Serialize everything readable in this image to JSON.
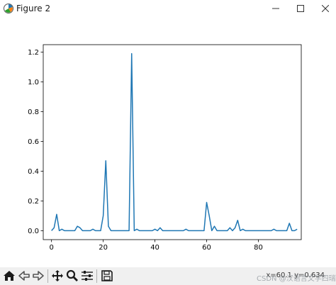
{
  "window": {
    "title": "Figure 2",
    "icon": "matplotlib-icon",
    "controls": [
      "minimize-icon",
      "maximize-icon",
      "close-icon"
    ]
  },
  "toolbar": {
    "buttons": [
      "home-icon",
      "back-arrow-icon",
      "forward-arrow-icon",
      "pan-icon",
      "zoom-icon",
      "configure-subplots-icon",
      "save-icon"
    ],
    "coords": "x=60.1  y=0.634"
  },
  "watermark": "CSDN @汉语言文学四瑞",
  "chart_data": {
    "type": "line",
    "title": "",
    "xlabel": "",
    "ylabel": "",
    "xlim": [
      -3.2,
      96.6
    ],
    "ylim": [
      -0.06,
      1.25
    ],
    "xticks": [
      0,
      20,
      40,
      60,
      80
    ],
    "yticks": [
      0.0,
      0.2,
      0.4,
      0.6,
      0.8,
      1.0,
      1.2
    ],
    "ytick_labels": [
      "0.0",
      "0.2",
      "0.4",
      "0.6",
      "0.8",
      "1.0",
      "1.2"
    ],
    "grid": false,
    "series": [
      {
        "color": "#1f77b4",
        "x": [
          0,
          1,
          2,
          3,
          4,
          5,
          6,
          7,
          8,
          9,
          10,
          11,
          12,
          13,
          14,
          15,
          16,
          17,
          18,
          19,
          20,
          21,
          22,
          23,
          24,
          25,
          26,
          27,
          28,
          29,
          30,
          31,
          32,
          33,
          34,
          35,
          36,
          37,
          38,
          39,
          40,
          41,
          42,
          43,
          44,
          45,
          46,
          47,
          48,
          49,
          50,
          51,
          52,
          53,
          54,
          55,
          56,
          57,
          58,
          59,
          60,
          61,
          62,
          63,
          64,
          65,
          66,
          67,
          68,
          69,
          70,
          71,
          72,
          73,
          74,
          75,
          76,
          77,
          78,
          79,
          80,
          81,
          82,
          83,
          84,
          85,
          86,
          87,
          88,
          89,
          90,
          91,
          92,
          93,
          94,
          95
        ],
        "y": [
          0.0,
          0.02,
          0.11,
          0.0,
          0.01,
          0.0,
          0.0,
          0.0,
          0.0,
          0.0,
          0.03,
          0.02,
          0.0,
          0.0,
          0.0,
          0.0,
          0.01,
          0.0,
          0.0,
          0.0,
          0.1,
          0.47,
          0.03,
          0.0,
          0.0,
          0.0,
          0.0,
          0.0,
          0.0,
          0.0,
          0.0,
          1.19,
          0.0,
          0.01,
          0.0,
          0.0,
          0.0,
          0.0,
          0.0,
          0.0,
          0.01,
          0.0,
          0.02,
          0.0,
          0.0,
          0.0,
          0.0,
          0.0,
          0.0,
          0.0,
          0.0,
          0.0,
          0.01,
          0.0,
          0.0,
          0.0,
          0.0,
          0.0,
          0.0,
          0.0,
          0.19,
          0.1,
          0.0,
          0.03,
          0.0,
          0.0,
          0.0,
          0.0,
          0.0,
          0.02,
          0.0,
          0.02,
          0.07,
          0.0,
          0.01,
          0.0,
          0.0,
          0.0,
          0.0,
          0.0,
          0.0,
          0.0,
          0.0,
          0.0,
          0.0,
          0.0,
          0.01,
          0.0,
          0.0,
          0.0,
          0.0,
          0.0,
          0.05,
          0.0,
          0.0,
          0.01
        ]
      }
    ]
  }
}
